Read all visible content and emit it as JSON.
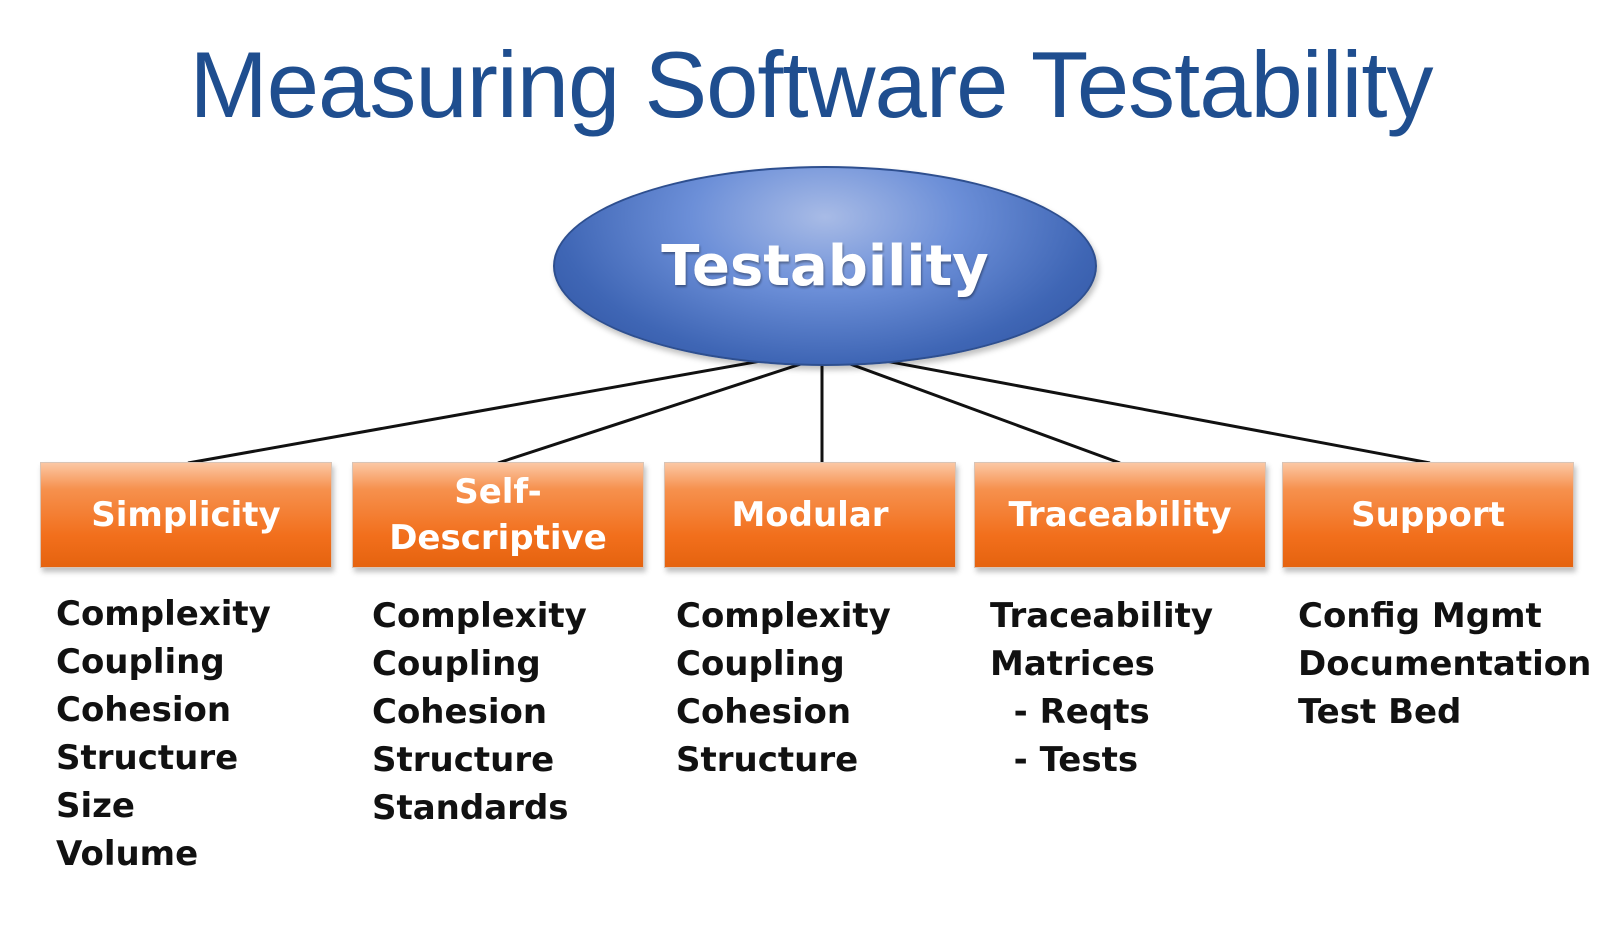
{
  "title": "Measuring Software Testability",
  "root": {
    "label": "Testability"
  },
  "children": [
    {
      "label": "Simplicity",
      "items": [
        "Complexity",
        "Coupling",
        "Cohesion",
        "Structure",
        "Size",
        "Volume"
      ]
    },
    {
      "label": "Self-\nDescriptive",
      "items": [
        "Complexity",
        "Coupling",
        "Cohesion",
        "Structure",
        "Standards"
      ]
    },
    {
      "label": "Modular",
      "items": [
        "Complexity",
        "Coupling",
        "Cohesion",
        "Structure"
      ]
    },
    {
      "label": "Traceability",
      "items": [
        "Traceability",
        "Matrices",
        "  - Reqts",
        "  - Tests"
      ]
    },
    {
      "label": "Support",
      "items": [
        "Config Mgmt",
        "Documentation",
        "Test Bed"
      ]
    }
  ],
  "colors": {
    "title": "#1f4e8f",
    "root_fill": "#3f66b5",
    "box_fill": "#f26f1c",
    "text": "#111111"
  }
}
